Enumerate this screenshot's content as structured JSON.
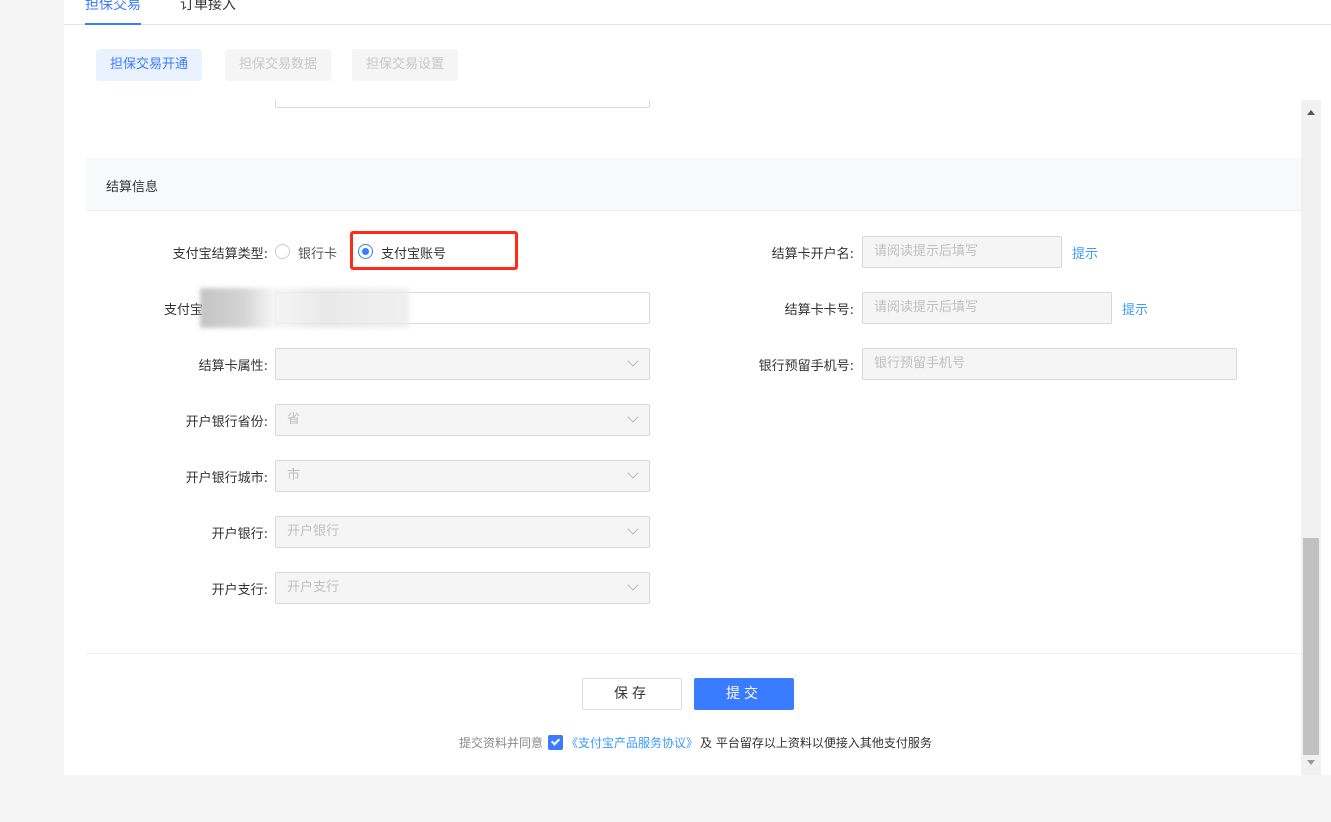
{
  "tabs": [
    "担保交易",
    "订单接入"
  ],
  "sub_buttons": [
    "担保交易开通",
    "担保交易数据",
    "担保交易设置"
  ],
  "section_title": "结算信息",
  "left": {
    "settle_type_label": "支付宝结算类型:",
    "radio_bank": "银行卡",
    "radio_alipay": "支付宝账号",
    "alipay_account_label": "支付宝",
    "card_attr_label": "结算卡属性:",
    "province_label": "开户银行省份:",
    "province_placeholder": "省",
    "city_label": "开户银行城市:",
    "city_placeholder": "市",
    "bank_label": "开户银行:",
    "bank_placeholder": "开户银行",
    "branch_label": "开户支行:",
    "branch_placeholder": "开户支行"
  },
  "right": {
    "holder_label": "结算卡开户名:",
    "holder_placeholder": "请阅读提示后填写",
    "card_no_label": "结算卡卡号:",
    "card_no_placeholder": "请阅读提示后填写",
    "phone_label": "银行预留手机号:",
    "phone_placeholder": "银行预留手机号",
    "hint": "提示"
  },
  "footer": {
    "save": "保存",
    "submit": "提交",
    "agree_prefix": "提交资料并同意",
    "agreement_link": "《支付宝产品服务协议》",
    "agree_suffix": "及 平台留存以上资料以便接入其他支付服务"
  },
  "colors": {
    "accent": "#3a7bff",
    "highlight": "#ff2a1a"
  }
}
